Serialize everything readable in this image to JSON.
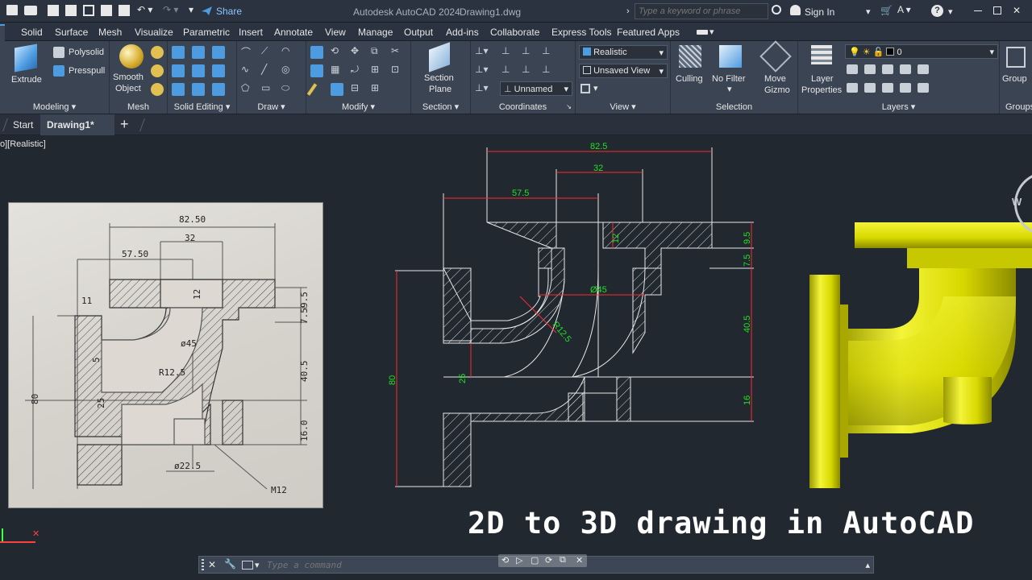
{
  "titlebar": {
    "share_label": "Share",
    "app_title": "Autodesk AutoCAD 2024",
    "file_name": "Drawing1.dwg",
    "search_placeholder": "Type a keyword or phrase",
    "sign_in": "Sign In"
  },
  "ribbon_tabs": [
    "Solid",
    "Surface",
    "Mesh",
    "Visualize",
    "Parametric",
    "Insert",
    "Annotate",
    "View",
    "Manage",
    "Output",
    "Add-ins",
    "Collaborate",
    "Express Tools",
    "Featured Apps"
  ],
  "ribbon": {
    "extrude": "Extrude",
    "polysolid": "Polysolid",
    "presspull": "Presspull",
    "smooth_object_1": "Smooth",
    "smooth_object_2": "Object",
    "section_plane_1": "Section",
    "section_plane_2": "Plane",
    "visual_style": "Realistic",
    "view_state": "Unsaved View",
    "ucs_name": "Unnamed",
    "culling": "Culling",
    "no_filter": "No Filter",
    "move_gizmo_1": "Move",
    "move_gizmo_2": "Gizmo",
    "layer_properties_1": "Layer",
    "layer_properties_2": "Properties",
    "layer_current": "0",
    "group": "Group",
    "panels": {
      "modeling": "Modeling",
      "mesh": "Mesh",
      "solid_editing": "Solid Editing",
      "draw": "Draw",
      "modify": "Modify",
      "section": "Section",
      "coordinates": "Coordinates",
      "view": "View",
      "selection": "Selection",
      "layers": "Layers",
      "groups": "Groups"
    }
  },
  "doc_tabs": {
    "start": "Start",
    "drawing": "Drawing1*"
  },
  "viewport": {
    "label": "o][Realistic]",
    "viewcube_label": "W"
  },
  "sketch": {
    "dim_8250": "82.50",
    "dim_32": "32",
    "dim_5750": "57.50",
    "dim_11": "11",
    "dim_12": "12",
    "dim_95": "9.5",
    "dim_75": "7.5",
    "dim_phi45": "ø45",
    "dim_r125": "R12.5",
    "dim_405": "40.5",
    "dim_5": "5",
    "dim_80": "80",
    "dim_25": "25",
    "dim_160": "16.0",
    "dim_phi225": "ø22.5",
    "dim_m12": "M12"
  },
  "cad": {
    "dim_825": "82.5",
    "dim_32": "32",
    "dim_575": "57.5",
    "dim_12": "12",
    "dim_95": "9.5",
    "dim_75": "7.5",
    "dim_phi45": "Ø45",
    "dim_r125": "R12.5",
    "dim_405": "40.5",
    "dim_80": "80",
    "dim_25": "25",
    "dim_16": "16"
  },
  "caption": "2D to 3D drawing in AutoCAD",
  "command": {
    "placeholder": "Type a command"
  },
  "colors": {
    "accent": "#4d9be0",
    "dimension_red": "#ff2a2a",
    "dimension_green": "#22e022",
    "solid_yellow": "#d8d800"
  }
}
